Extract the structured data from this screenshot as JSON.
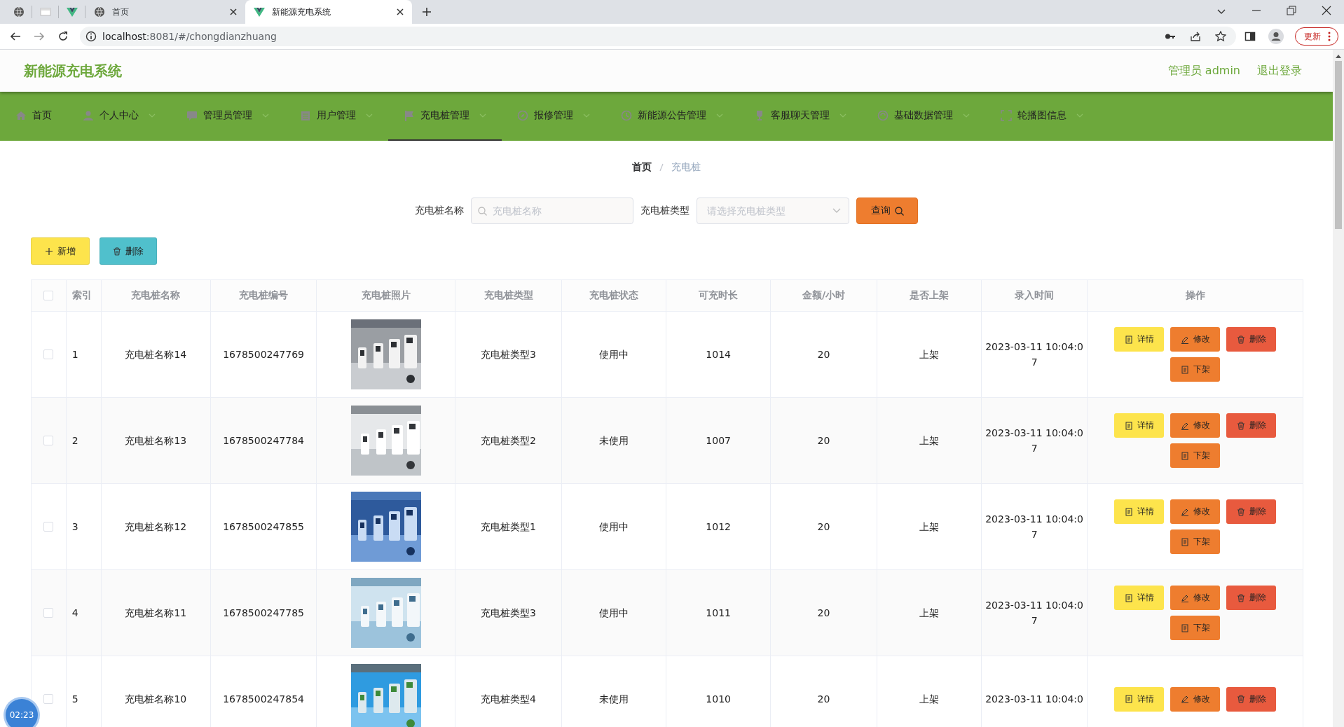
{
  "browser": {
    "tabs": [
      {
        "kind": "pinned",
        "selected": false
      },
      {
        "kind": "pinned",
        "selected": false
      },
      {
        "kind": "pinned",
        "selected": false
      },
      {
        "kind": "page",
        "title": "首页",
        "selected": false
      },
      {
        "kind": "page",
        "title": "新能源充电系统",
        "selected": true
      }
    ],
    "url_host": "localhost",
    "url_rest": ":8081/#/chongdianzhuang",
    "update_label": "更新"
  },
  "header": {
    "title": "新能源充电系统",
    "user": "管理员 admin",
    "logout": "退出登录"
  },
  "nav": [
    {
      "label": "首页",
      "dropdown": false,
      "selected": false
    },
    {
      "label": "个人中心",
      "dropdown": true,
      "selected": false
    },
    {
      "label": "管理员管理",
      "dropdown": true,
      "selected": false
    },
    {
      "label": "用户管理",
      "dropdown": true,
      "selected": false
    },
    {
      "label": "充电桩管理",
      "dropdown": true,
      "selected": true
    },
    {
      "label": "报修管理",
      "dropdown": true,
      "selected": false
    },
    {
      "label": "新能源公告管理",
      "dropdown": true,
      "selected": false
    },
    {
      "label": "客服聊天管理",
      "dropdown": true,
      "selected": false
    },
    {
      "label": "基础数据管理",
      "dropdown": true,
      "selected": false
    },
    {
      "label": "轮播图信息",
      "dropdown": true,
      "selected": false
    }
  ],
  "breadcrumb": [
    {
      "label": "首页",
      "current": false
    },
    {
      "label": "充电桩",
      "current": true
    }
  ],
  "search": {
    "name_label": "充电桩名称",
    "name_placeholder": "充电桩名称",
    "type_label": "充电桩类型",
    "type_placeholder": "请选择充电桩类型",
    "query_button": "查询"
  },
  "toolbar": [
    {
      "kind": "add",
      "label": "新增"
    },
    {
      "kind": "delete",
      "label": "删除"
    }
  ],
  "table": {
    "all_checked": false,
    "columns": [
      "索引",
      "充电桩名称",
      "充电桩编号",
      "充电桩照片",
      "充电桩类型",
      "充电桩状态",
      "可充时长",
      "金额/小时",
      "是否上架",
      "录入时间",
      "操作"
    ],
    "rows": [
      {
        "checked": false,
        "index": "1",
        "name": "充电桩名称14",
        "code": "1678500247769",
        "type": "充电桩类型3",
        "status": "使用中",
        "duration": "1014",
        "price": "20",
        "listed": "上架",
        "time": "2023-03-11 10:04:07",
        "actions": [
          {
            "kind": "detail",
            "label": "详情"
          },
          {
            "kind": "edit",
            "label": "修改"
          },
          {
            "kind": "delete",
            "label": "删除"
          },
          {
            "kind": "unlist",
            "label": "下架"
          }
        ]
      },
      {
        "checked": false,
        "index": "2",
        "name": "充电桩名称13",
        "code": "1678500247784",
        "type": "充电桩类型2",
        "status": "未使用",
        "duration": "1007",
        "price": "20",
        "listed": "上架",
        "time": "2023-03-11 10:04:07",
        "actions": [
          {
            "kind": "detail",
            "label": "详情"
          },
          {
            "kind": "edit",
            "label": "修改"
          },
          {
            "kind": "delete",
            "label": "删除"
          },
          {
            "kind": "unlist",
            "label": "下架"
          }
        ]
      },
      {
        "checked": false,
        "index": "3",
        "name": "充电桩名称12",
        "code": "1678500247855",
        "type": "充电桩类型1",
        "status": "使用中",
        "duration": "1012",
        "price": "20",
        "listed": "上架",
        "time": "2023-03-11 10:04:07",
        "actions": [
          {
            "kind": "detail",
            "label": "详情"
          },
          {
            "kind": "edit",
            "label": "修改"
          },
          {
            "kind": "delete",
            "label": "删除"
          },
          {
            "kind": "unlist",
            "label": "下架"
          }
        ]
      },
      {
        "checked": false,
        "index": "4",
        "name": "充电桩名称11",
        "code": "1678500247785",
        "type": "充电桩类型3",
        "status": "使用中",
        "duration": "1011",
        "price": "20",
        "listed": "上架",
        "time": "2023-03-11 10:04:07",
        "actions": [
          {
            "kind": "detail",
            "label": "详情"
          },
          {
            "kind": "edit",
            "label": "修改"
          },
          {
            "kind": "delete",
            "label": "删除"
          },
          {
            "kind": "unlist",
            "label": "下架"
          }
        ]
      },
      {
        "checked": false,
        "index": "5",
        "name": "充电桩名称10",
        "code": "1678500247854",
        "type": "充电桩类型4",
        "status": "未使用",
        "duration": "1010",
        "price": "20",
        "listed": "上架",
        "time": "2023-03-11 10:04:0",
        "actions": [
          {
            "kind": "detail",
            "label": "详情"
          },
          {
            "kind": "edit",
            "label": "修改"
          },
          {
            "kind": "delete",
            "label": "删除"
          }
        ]
      }
    ]
  },
  "timer": "02:23"
}
